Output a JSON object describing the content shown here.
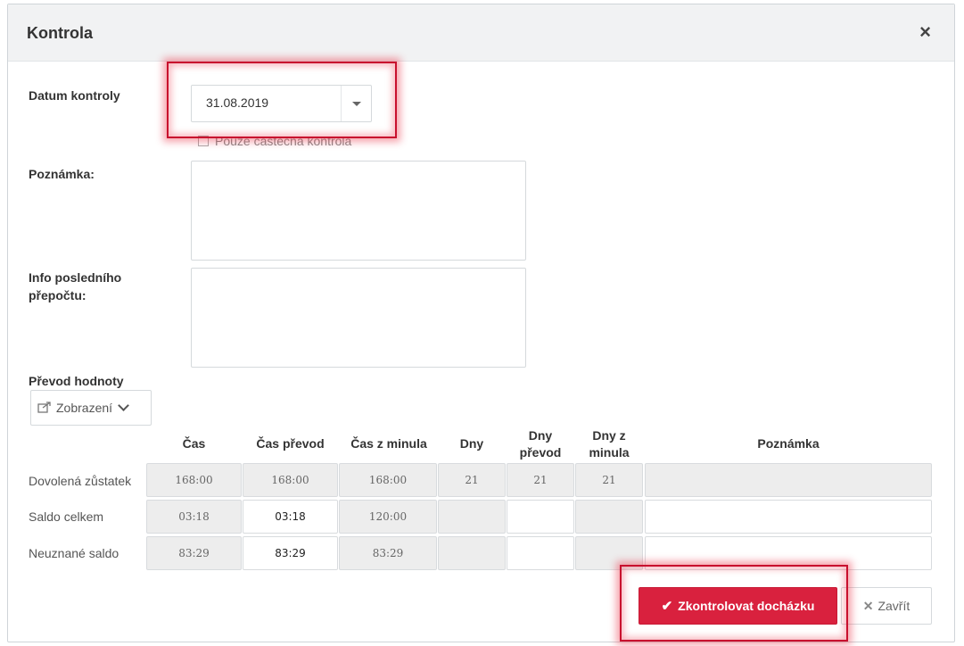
{
  "dialog": {
    "title": "Kontrola",
    "close_glyph": "×"
  },
  "form": {
    "date_label": "Datum kontroly",
    "date_value": "31.08.2019",
    "partial_check_label": "Pouze částečná kontrola",
    "note_label": "Poznámka:",
    "info_label_line1": "Info posledního",
    "info_label_line2": "přepočtu:",
    "transfer_label": "Převod hodnoty",
    "display_dropdown": "Zobrazení"
  },
  "table": {
    "headers": {
      "cas": "Čas",
      "cas_prevod": "Čas převod",
      "cas_z_minula": "Čas z minula",
      "dny": "Dny",
      "dny_prevod_1": "Dny",
      "dny_prevod_2": "převod",
      "dny_z_minula_1": "Dny z",
      "dny_z_minula_2": "minula",
      "poznamka": "Poznámka"
    },
    "rows": [
      {
        "label": "Dovolená zůstatek",
        "cas": "168:00",
        "cas_prevod": "168:00",
        "cas_z_minula": "168:00",
        "dny": "21",
        "dny_prevod": "21",
        "dny_z_minula": "21",
        "poznamka": ""
      },
      {
        "label": "Saldo celkem",
        "cas": "03:18",
        "cas_prevod": "03:18",
        "cas_z_minula": "120:00",
        "dny": "",
        "dny_prevod": "",
        "dny_z_minula": "",
        "poznamka": ""
      },
      {
        "label": "Neuznané saldo",
        "cas": "83:29",
        "cas_prevod": "83:29",
        "cas_z_minula": "83:29",
        "dny": "",
        "dny_prevod": "",
        "dny_z_minula": "",
        "poznamka": ""
      }
    ]
  },
  "footer": {
    "confirm_label": "Zkontrolovat docházku",
    "close_label": "Zavřít"
  },
  "colors": {
    "primary": "#d9213e",
    "highlight": "#c8102e"
  }
}
